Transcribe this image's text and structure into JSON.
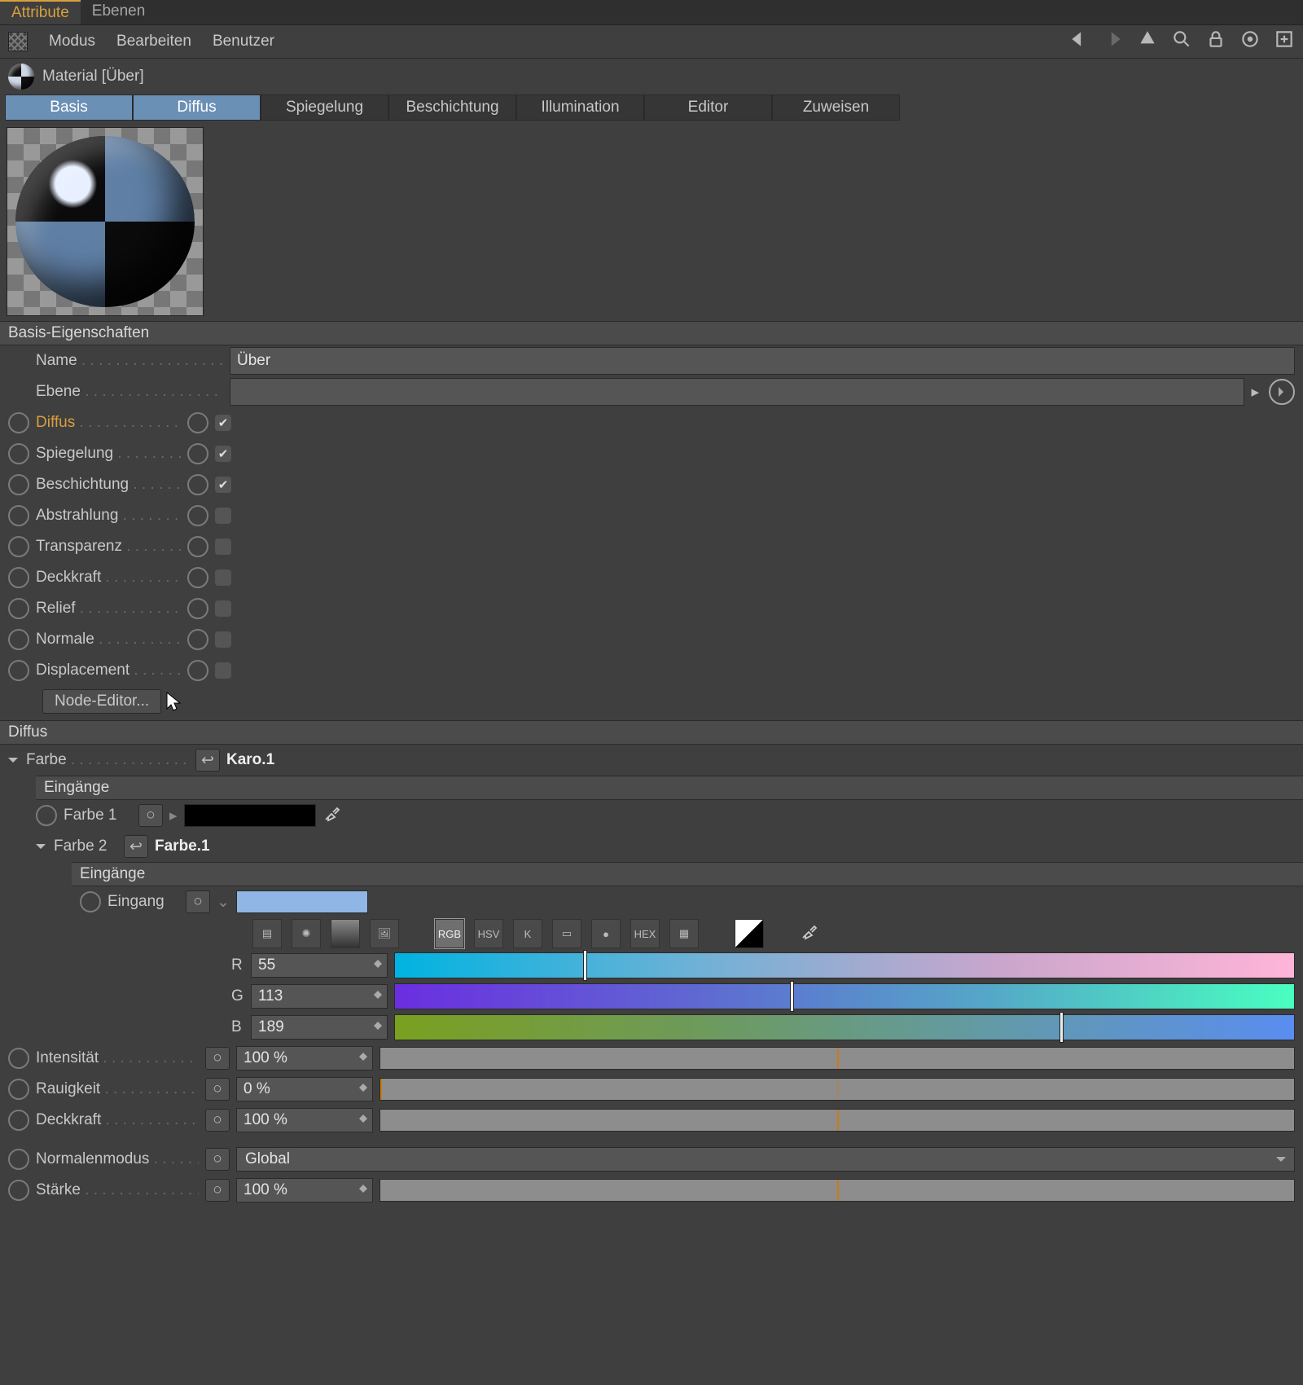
{
  "top_tabs": {
    "attribute": "Attribute",
    "layers": "Ebenen"
  },
  "menus": {
    "mode": "Modus",
    "edit": "Bearbeiten",
    "user": "Benutzer"
  },
  "material": {
    "title": "Material [Über]"
  },
  "channels": [
    "Basis",
    "Diffus",
    "Spiegelung",
    "Beschichtung",
    "Illumination",
    "Editor",
    "Zuweisen"
  ],
  "section_basis": "Basis-Eigenschaften",
  "basis": {
    "name_label": "Name",
    "name_value": "Über",
    "layer_label": "Ebene",
    "props": [
      {
        "label": "Diffus",
        "checked": true,
        "active": true
      },
      {
        "label": "Spiegelung",
        "checked": true
      },
      {
        "label": "Beschichtung",
        "checked": true
      },
      {
        "label": "Abstrahlung",
        "checked": false
      },
      {
        "label": "Transparenz",
        "checked": false
      },
      {
        "label": "Deckkraft",
        "checked": false
      },
      {
        "label": "Relief",
        "checked": false
      },
      {
        "label": "Normale",
        "checked": false
      },
      {
        "label": "Displacement",
        "checked": false
      }
    ],
    "node_editor": "Node-Editor..."
  },
  "diffus": {
    "header": "Diffus",
    "farbe_label": "Farbe",
    "farbe_link": "Karo.1",
    "inputs_hdr": "Eingänge",
    "farbe1_label": "Farbe 1",
    "farbe2_label": "Farbe 2",
    "farbe2_link": "Farbe.1",
    "eingang_label": "Eingang",
    "color_modes": {
      "rgb": "RGB",
      "hsv": "HSV",
      "k": "K",
      "hex": "HEX"
    },
    "r": {
      "label": "R",
      "value": "55",
      "pct": 21
    },
    "g": {
      "label": "G",
      "value": "113",
      "pct": 44
    },
    "b": {
      "label": "B",
      "value": "189",
      "pct": 74
    },
    "swatch_hex": "#8fb6e4",
    "intensitaet": {
      "label": "Intensität",
      "value": "100 %",
      "pct": 50
    },
    "rauigkeit": {
      "label": "Rauigkeit",
      "value": "0 %",
      "pct": 0
    },
    "deckkraft": {
      "label": "Deckkraft",
      "value": "100 %",
      "pct": 50
    },
    "normalmode": {
      "label": "Normalenmodus",
      "value": "Global"
    },
    "staerke": {
      "label": "Stärke",
      "value": "100 %",
      "pct": 50
    }
  }
}
